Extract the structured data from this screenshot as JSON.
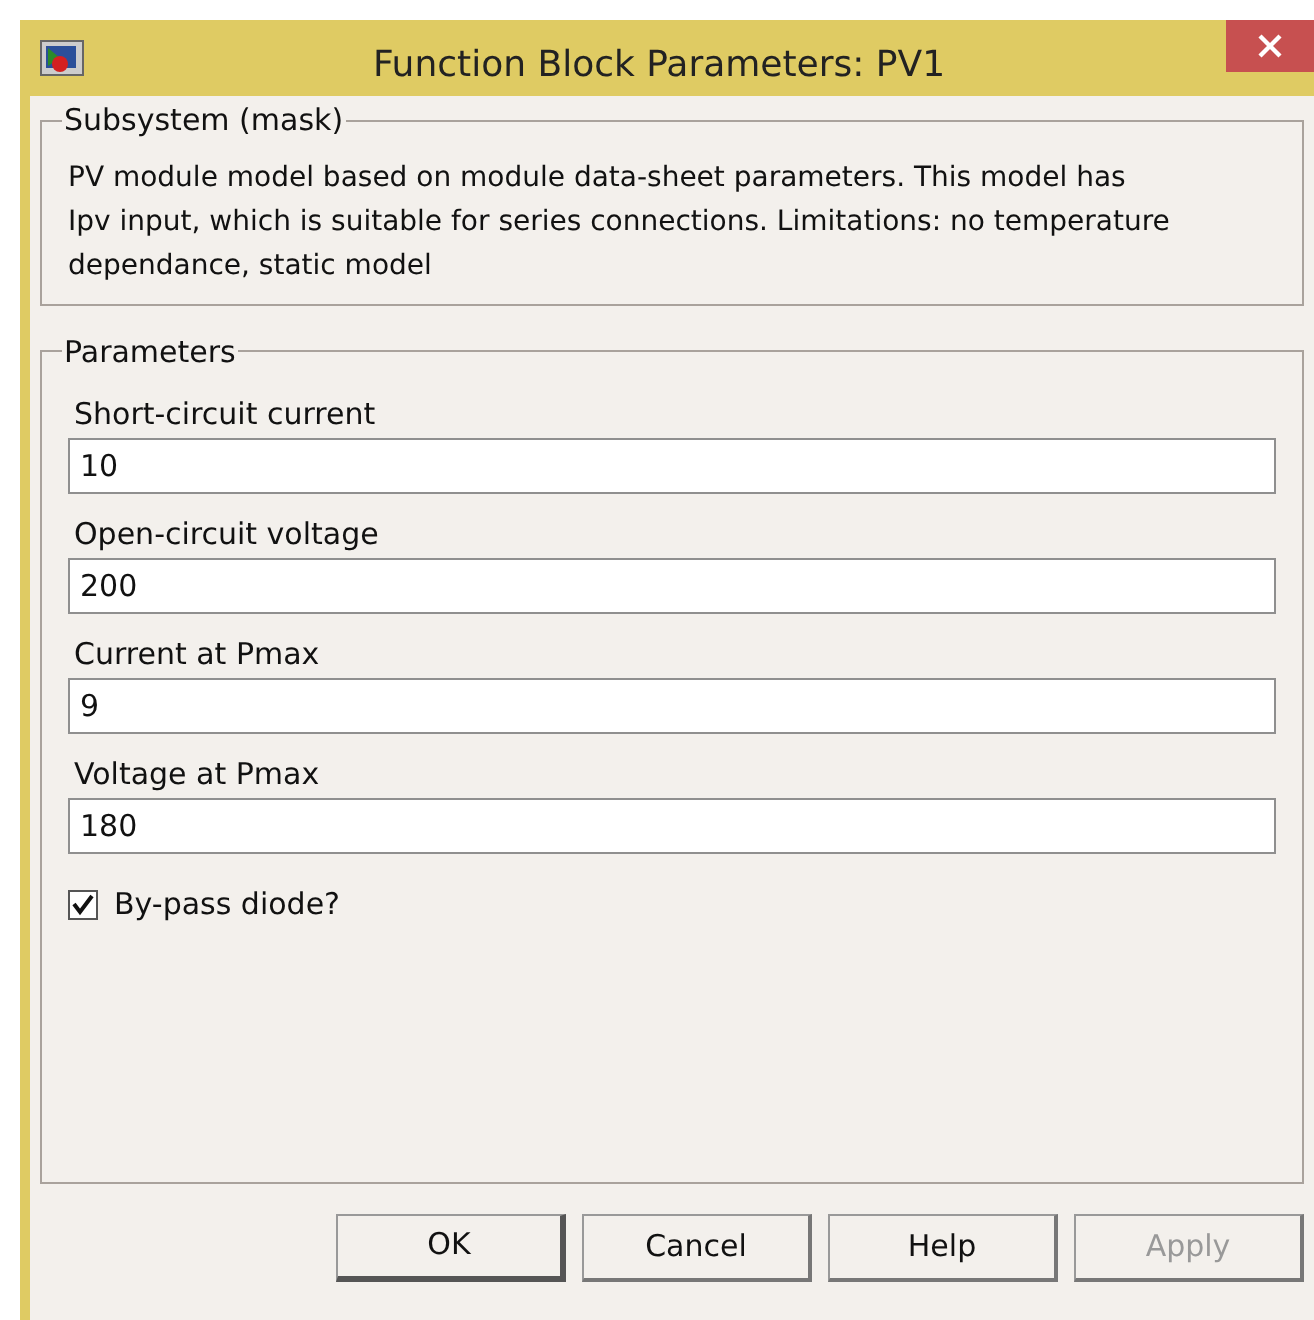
{
  "window": {
    "title": "Function Block Parameters: PV1"
  },
  "description_group": {
    "title": "Subsystem (mask)",
    "text": "PV module model based on module data-sheet parameters. This model has Ipv input, which is suitable for series connections. Limitations: no temperature dependance, static model"
  },
  "parameters_group": {
    "title": "Parameters",
    "fields": [
      {
        "label": "Short-circuit current",
        "value": "10"
      },
      {
        "label": "Open-circuit voltage",
        "value": "200"
      },
      {
        "label": "Current at Pmax",
        "value": "9"
      },
      {
        "label": "Voltage at Pmax",
        "value": "180"
      }
    ],
    "checkbox": {
      "label": "By-pass diode?",
      "checked": true
    }
  },
  "buttons": [
    {
      "label": "OK",
      "disabled": false,
      "default": true
    },
    {
      "label": "Cancel",
      "disabled": false,
      "default": false
    },
    {
      "label": "Help",
      "disabled": false,
      "default": false
    },
    {
      "label": "Apply",
      "disabled": true,
      "default": false
    }
  ]
}
